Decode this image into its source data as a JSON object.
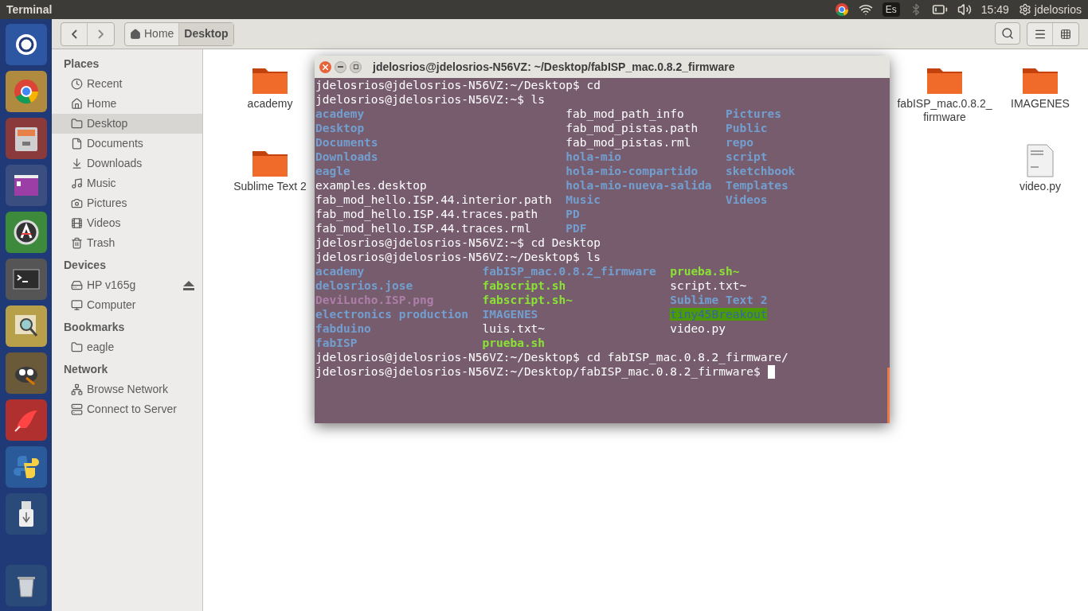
{
  "top_bar": {
    "title": "Terminal",
    "keyboard": "Es",
    "time": "15:49",
    "user": "jdelosrios"
  },
  "toolbar": {
    "breadcrumbs": [
      {
        "label": "Home",
        "selected": false
      },
      {
        "label": "Desktop",
        "selected": true
      }
    ]
  },
  "sidebar": {
    "sections": [
      {
        "title": "Places",
        "items": [
          {
            "label": "Recent",
            "selected": false
          },
          {
            "label": "Home",
            "selected": false
          },
          {
            "label": "Desktop",
            "selected": true
          },
          {
            "label": "Documents",
            "selected": false
          },
          {
            "label": "Downloads",
            "selected": false
          },
          {
            "label": "Music",
            "selected": false
          },
          {
            "label": "Pictures",
            "selected": false
          },
          {
            "label": "Videos",
            "selected": false
          },
          {
            "label": "Trash",
            "selected": false
          }
        ]
      },
      {
        "title": "Devices",
        "items": [
          {
            "label": "HP v165g",
            "selected": false,
            "ejectable": true
          },
          {
            "label": "Computer",
            "selected": false,
            "ejectable": false
          }
        ]
      },
      {
        "title": "Bookmarks",
        "items": [
          {
            "label": "eagle",
            "selected": false
          }
        ]
      },
      {
        "title": "Network",
        "items": [
          {
            "label": "Browse Network",
            "selected": false
          },
          {
            "label": "Connect to Server",
            "selected": false
          }
        ]
      }
    ]
  },
  "desktop_items": [
    {
      "label": "academy",
      "kind": "folder"
    },
    {
      "label": "fabISP_mac.0.8.2_ firmware",
      "kind": "folder"
    },
    {
      "label": "IMAGENES",
      "kind": "folder"
    },
    {
      "label": "Sublime Text 2",
      "kind": "folder"
    },
    {
      "label": "video.py",
      "kind": "script"
    }
  ],
  "terminal": {
    "title": "jdelosrios@jdelosrios-N56VZ: ~/Desktop/fabISP_mac.0.8.2_firmware",
    "lines": [
      {
        "kind": "prompt",
        "text": "jdelosrios@jdelosrios-N56VZ:~/Desktop$ cd"
      },
      {
        "kind": "prompt",
        "text": "jdelosrios@jdelosrios-N56VZ:~$ ls"
      },
      {
        "kind": "listing",
        "rows": [
          [
            {
              "text": "academy",
              "kind": "dir"
            },
            {
              "text": "fab_mod_path_info",
              "kind": "file"
            },
            {
              "text": "Pictures",
              "kind": "dir"
            }
          ],
          [
            {
              "text": "Desktop",
              "kind": "dir"
            },
            {
              "text": "fab_mod_pistas.path",
              "kind": "file"
            },
            {
              "text": "Public",
              "kind": "dir"
            }
          ],
          [
            {
              "text": "Documents",
              "kind": "dir"
            },
            {
              "text": "fab_mod_pistas.rml",
              "kind": "file"
            },
            {
              "text": "repo",
              "kind": "dir"
            }
          ],
          [
            {
              "text": "Downloads",
              "kind": "dir"
            },
            {
              "text": "hola-mio",
              "kind": "dir"
            },
            {
              "text": "script",
              "kind": "dir"
            }
          ],
          [
            {
              "text": "eagle",
              "kind": "dir"
            },
            {
              "text": "hola-mio-compartido",
              "kind": "dir"
            },
            {
              "text": "sketchbook",
              "kind": "dir"
            }
          ],
          [
            {
              "text": "examples.desktop",
              "kind": "file"
            },
            {
              "text": "hola-mio-nueva-salida",
              "kind": "dir"
            },
            {
              "text": "Templates",
              "kind": "dir"
            }
          ],
          [
            {
              "text": "fab_mod_hello.ISP.44.interior.path",
              "kind": "file"
            },
            {
              "text": "Music",
              "kind": "dir"
            },
            {
              "text": "Videos",
              "kind": "dir"
            }
          ],
          [
            {
              "text": "fab_mod_hello.ISP.44.traces.path",
              "kind": "file"
            },
            {
              "text": "PD",
              "kind": "dir"
            }
          ],
          [
            {
              "text": "fab_mod_hello.ISP.44.traces.rml",
              "kind": "file"
            },
            {
              "text": "PDF",
              "kind": "dir"
            }
          ]
        ]
      },
      {
        "kind": "prompt",
        "text": "jdelosrios@jdelosrios-N56VZ:~$ cd Desktop"
      },
      {
        "kind": "prompt",
        "text": "jdelosrios@jdelosrios-N56VZ:~/Desktop$ ls"
      },
      {
        "kind": "listing",
        "rows": [
          [
            {
              "text": "academy",
              "kind": "dir"
            },
            {
              "text": "fabISP_mac.0.8.2_firmware",
              "kind": "dir"
            },
            {
              "text": "prueba.sh~",
              "kind": "exec"
            }
          ],
          [
            {
              "text": "delosrios.jose",
              "kind": "dir"
            },
            {
              "text": "fabscript.sh",
              "kind": "exec"
            },
            {
              "text": "script.txt~",
              "kind": "file"
            }
          ],
          [
            {
              "text": "DeviLucho.ISP.png",
              "kind": "image"
            },
            {
              "text": "fabscript.sh~",
              "kind": "exec"
            },
            {
              "text": "Sublime Text 2",
              "kind": "dir"
            }
          ],
          [
            {
              "text": "electronics production",
              "kind": "dir"
            },
            {
              "text": "IMAGENES",
              "kind": "dir"
            },
            {
              "text": "tiny45Breakout",
              "kind": "shared_dir"
            }
          ],
          [
            {
              "text": "fabduino",
              "kind": "dir"
            },
            {
              "text": "luis.txt~",
              "kind": "file"
            },
            {
              "text": "video.py",
              "kind": "file"
            }
          ],
          [
            {
              "text": "fabISP",
              "kind": "dir"
            },
            {
              "text": "prueba.sh",
              "kind": "exec"
            }
          ]
        ]
      },
      {
        "kind": "prompt",
        "text": "jdelosrios@jdelosrios-N56VZ:~/Desktop$ cd fabISP_mac.0.8.2_firmware/"
      },
      {
        "kind": "prompt",
        "text": "jdelosrios@jdelosrios-N56VZ:~/Desktop/fabISP_mac.0.8.2_firmware$",
        "cursor": true
      }
    ]
  }
}
